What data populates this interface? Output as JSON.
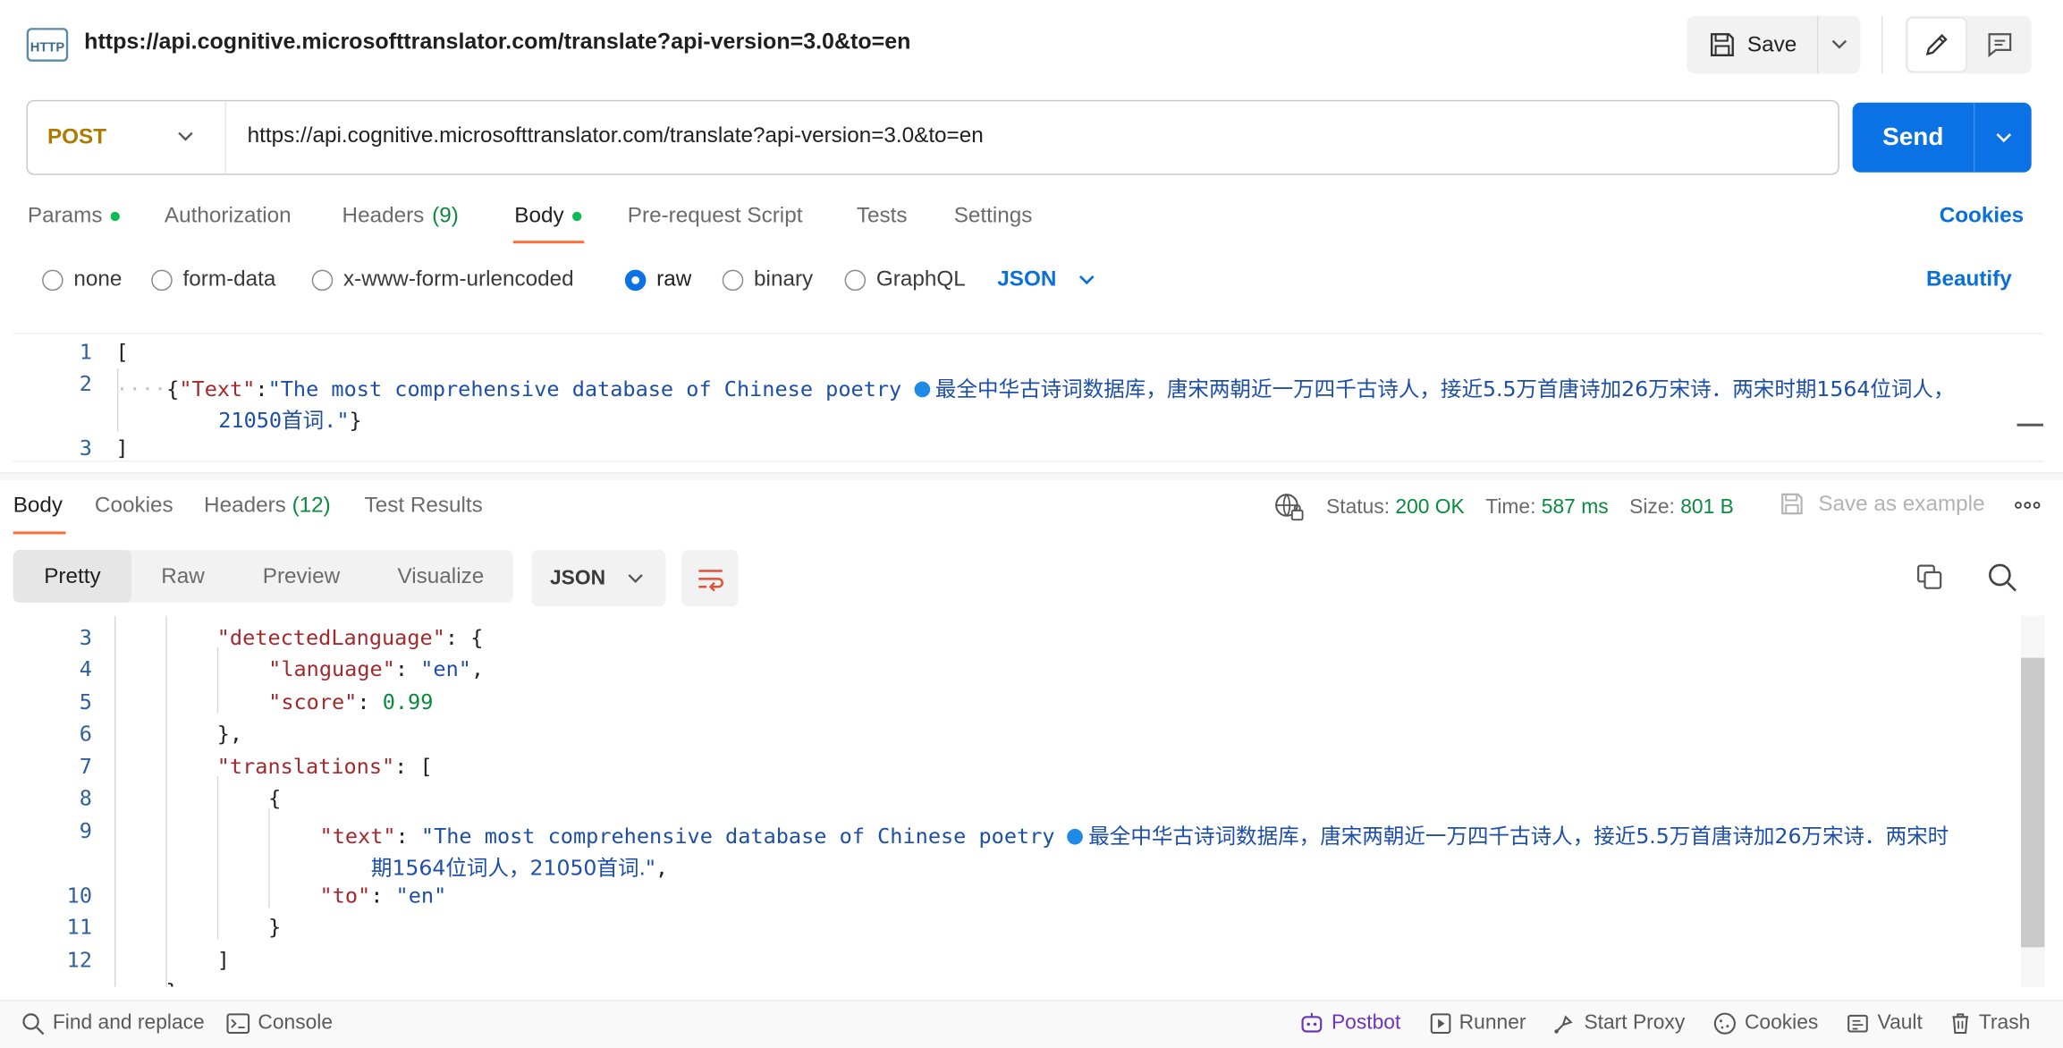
{
  "header": {
    "title": "https://api.cognitive.microsofttranslator.com/translate?api-version=3.0&to=en",
    "http_badge": "HTTP",
    "save_label": "Save"
  },
  "request": {
    "method": "POST",
    "url": "https://api.cognitive.microsofttranslator.com/translate?api-version=3.0&to=en",
    "send_label": "Send",
    "method_color": "#ad7a03",
    "accent": "#0b72e6"
  },
  "request_tabs": {
    "params": "Params",
    "authorization": "Authorization",
    "headers": "Headers",
    "headers_count": "(9)",
    "body": "Body",
    "prerequest": "Pre-request Script",
    "tests": "Tests",
    "settings": "Settings",
    "cookies": "Cookies"
  },
  "body_types": {
    "none": "none",
    "form_data": "form-data",
    "urlencoded": "x-www-form-urlencoded",
    "raw": "raw",
    "binary": "binary",
    "graphql": "GraphQL",
    "format": "JSON",
    "beautify": "Beautify",
    "selected": "raw"
  },
  "request_body": {
    "line_numbers": [
      "1",
      "2",
      "3"
    ],
    "open": "[",
    "close": "]",
    "key": "\"Text\"",
    "colon": ":",
    "text_en": "\"The most comprehensive database of Chinese poetry ",
    "text_cn_1": "最全中华古诗词数据库，唐宋两朝近一万四千古诗人，接近5.5万首唐诗加26万宋诗．两宋时期1564位词人，",
    "text_cn_2": "21050首词.\""
  },
  "response_tabs": {
    "body": "Body",
    "cookies": "Cookies",
    "headers": "Headers",
    "headers_count": "(12)",
    "test_results": "Test Results"
  },
  "response_meta": {
    "status_label": "Status:",
    "status_value": "200 OK",
    "time_label": "Time:",
    "time_value": "587 ms",
    "size_label": "Size:",
    "size_value": "801 B",
    "save_example": "Save as example"
  },
  "response_view": {
    "pretty": "Pretty",
    "raw": "Raw",
    "preview": "Preview",
    "visualize": "Visualize",
    "format": "JSON"
  },
  "response_body": {
    "ln": [
      "3",
      "4",
      "5",
      "6",
      "7",
      "8",
      "9",
      "10",
      "11",
      "12"
    ],
    "detected_key": "\"detectedLanguage\"",
    "language_key": "\"language\"",
    "language_val": "\"en\"",
    "score_key": "\"score\"",
    "score_val": "0.99",
    "translations_key": "\"translations\"",
    "text_key": "\"text\"",
    "text_en": "\"The most comprehensive database of Chinese poetry ",
    "text_cn_1": "最全中华古诗词数据库，唐宋两朝近一万四千古诗人，接近5.5万首唐诗加26万宋诗．两宋时",
    "text_cn_2": "期1564位词人，21050首词.\"",
    "to_key": "\"to\"",
    "to_val": "\"en\""
  },
  "footer": {
    "find_replace": "Find and replace",
    "console": "Console",
    "postbot": "Postbot",
    "runner": "Runner",
    "start_proxy": "Start Proxy",
    "cookies": "Cookies",
    "vault": "Vault",
    "trash": "Trash"
  }
}
